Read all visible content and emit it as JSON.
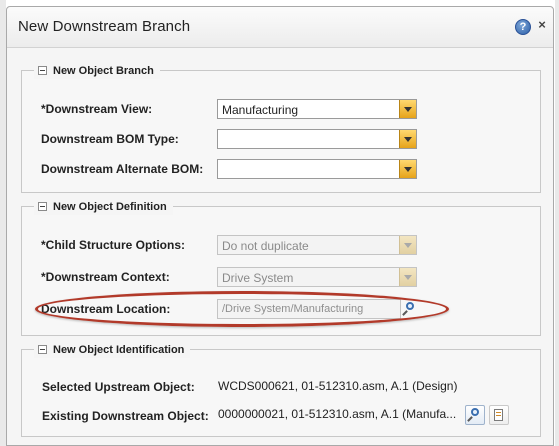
{
  "dialog": {
    "title": "New Downstream Branch",
    "help_glyph": "?",
    "close_glyph": "×"
  },
  "sections": {
    "branch": {
      "legend": "New Object Branch",
      "downstream_view_label": "*Downstream View:",
      "downstream_view_value": "Manufacturing",
      "bom_type_label": "Downstream BOM Type:",
      "bom_type_value": "",
      "alt_bom_label": "Downstream Alternate BOM:",
      "alt_bom_value": ""
    },
    "definition": {
      "legend": "New Object Definition",
      "child_structure_label": "*Child Structure Options:",
      "child_structure_value": "Do not duplicate",
      "context_label": "*Downstream Context:",
      "context_value": "Drive System",
      "location_label": "Downstream Location:",
      "location_value": "/Drive System/Manufacturing"
    },
    "identification": {
      "legend": "New Object Identification",
      "upstream_label": "Selected Upstream Object:",
      "upstream_value": "WCDS000621, 01-512310.asm, A.1 (Design)",
      "existing_label": "Existing Downstream Object:",
      "existing_value": "0000000021, 01-512310.asm, A.1 (Manufa..."
    }
  },
  "icons": {
    "help": "help-icon",
    "close": "close-icon",
    "collapse": "collapse-icon",
    "dropdown": "dropdown-arrow-icon",
    "search": "search-icon",
    "document": "document-icon"
  },
  "colors": {
    "dropdown_accent": "#e6a21a",
    "highlight": "#b23a2a",
    "help_blue": "#2b5ea8"
  }
}
